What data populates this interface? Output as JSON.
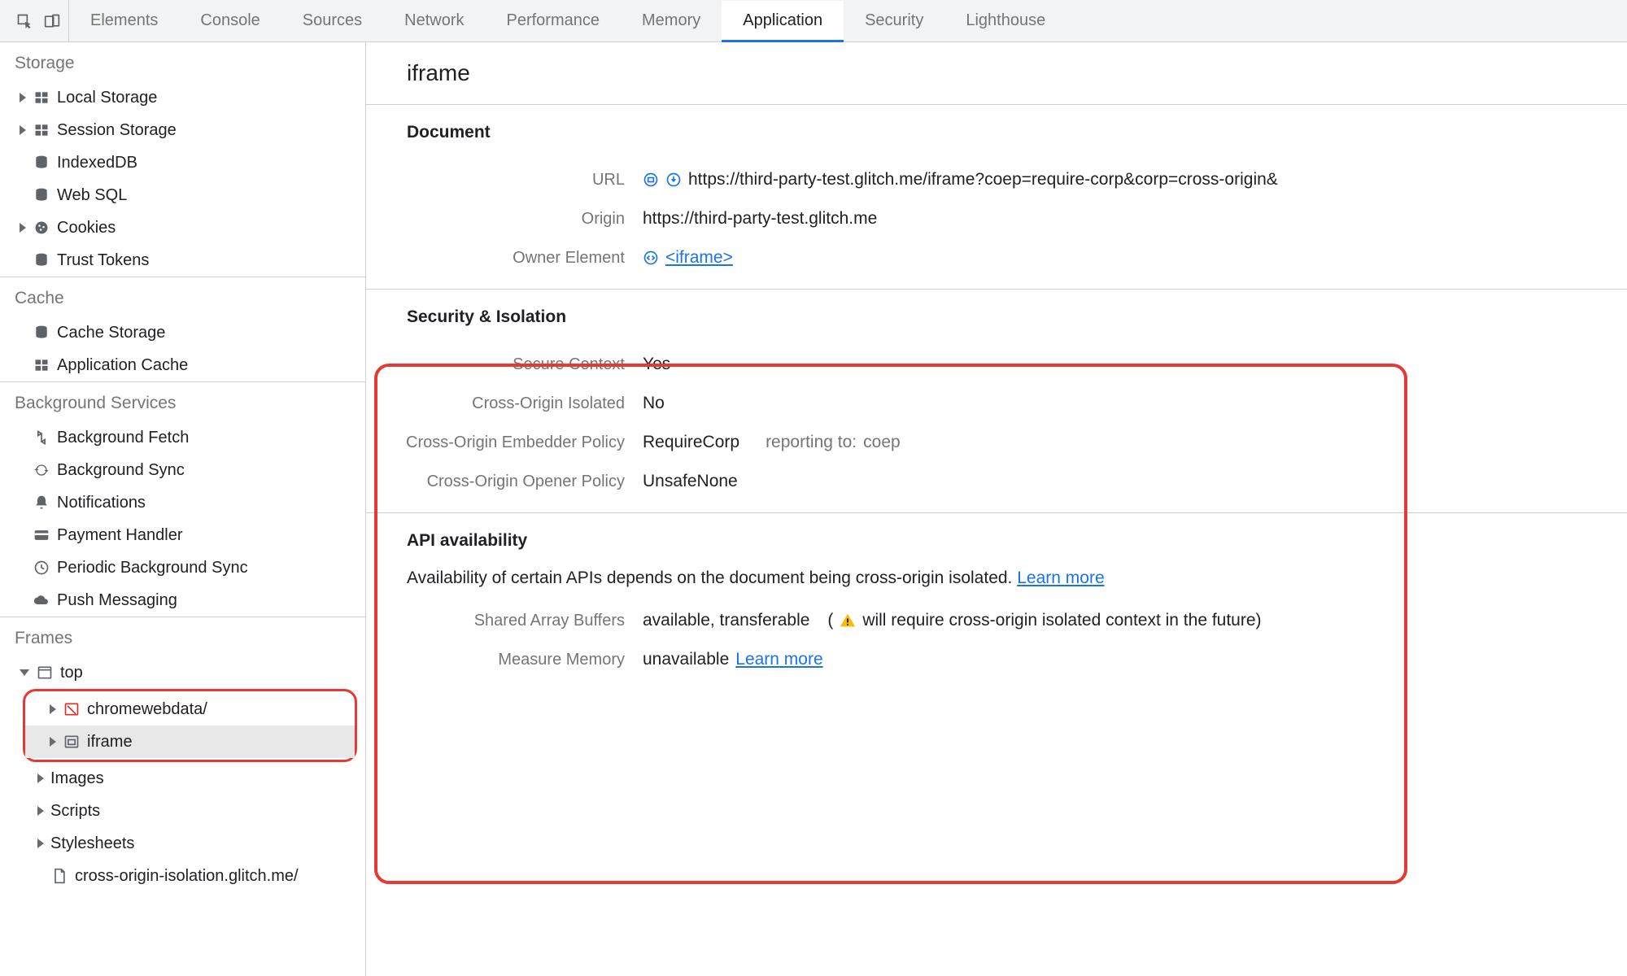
{
  "topbar": {
    "tabs": [
      {
        "label": "Elements",
        "active": false
      },
      {
        "label": "Console",
        "active": false
      },
      {
        "label": "Sources",
        "active": false
      },
      {
        "label": "Network",
        "active": false
      },
      {
        "label": "Performance",
        "active": false
      },
      {
        "label": "Memory",
        "active": false
      },
      {
        "label": "Application",
        "active": true
      },
      {
        "label": "Security",
        "active": false
      },
      {
        "label": "Lighthouse",
        "active": false
      }
    ]
  },
  "sidebar": {
    "sections": {
      "storage": "Storage",
      "cache": "Cache",
      "bg": "Background Services",
      "frames": "Frames"
    },
    "storage_items": {
      "local_storage": "Local Storage",
      "session_storage": "Session Storage",
      "indexeddb": "IndexedDB",
      "websql": "Web SQL",
      "cookies": "Cookies",
      "trust_tokens": "Trust Tokens"
    },
    "cache_items": {
      "cache_storage": "Cache Storage",
      "application_cache": "Application Cache"
    },
    "bg_items": {
      "background_fetch": "Background Fetch",
      "background_sync": "Background Sync",
      "notifications": "Notifications",
      "payment_handler": "Payment Handler",
      "periodic_sync": "Periodic Background Sync",
      "push_messaging": "Push Messaging"
    },
    "frames_items": {
      "top": "top",
      "chromewebdata": "chromewebdata/",
      "iframe": "iframe",
      "images": "Images",
      "scripts": "Scripts",
      "stylesheets": "Stylesheets",
      "cross_origin": "cross-origin-isolation.glitch.me/"
    }
  },
  "main": {
    "title": "iframe",
    "document": {
      "heading": "Document",
      "url_label": "URL",
      "url_value": "https://third-party-test.glitch.me/iframe?coep=require-corp&corp=cross-origin&",
      "origin_label": "Origin",
      "origin_value": "https://third-party-test.glitch.me",
      "owner_label": "Owner Element",
      "owner_value": "<iframe>"
    },
    "security": {
      "heading": "Security & Isolation",
      "secure_context_label": "Secure Context",
      "secure_context_value": "Yes",
      "coi_label": "Cross-Origin Isolated",
      "coi_value": "No",
      "coep_label": "Cross-Origin Embedder Policy",
      "coep_value": "RequireCorp",
      "coep_reporting_label": "reporting to:",
      "coep_reporting_value": "coep",
      "coop_label": "Cross-Origin Opener Policy",
      "coop_value": "UnsafeNone"
    },
    "api": {
      "heading": "API availability",
      "desc": "Availability of certain APIs depends on the document being cross-origin isolated.",
      "learn_more": "Learn more",
      "sab_label": "Shared Array Buffers",
      "sab_value": "available, transferable",
      "sab_warn": "will require cross-origin isolated context in the future)",
      "sab_warn_prefix": "(",
      "mm_label": "Measure Memory",
      "mm_value": "unavailable",
      "mm_learn_more": "Learn more"
    }
  }
}
